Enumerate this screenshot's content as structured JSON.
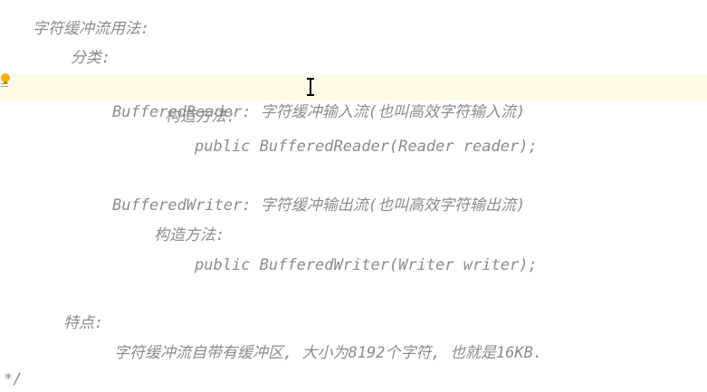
{
  "editor": {
    "top_mark": "'",
    "lines": [
      "字符缓冲流用法:",
      "分类:",
      "BufferedReader: 字符缓冲输入流(也叫高效字符输入流)",
      "构造方法:",
      "public BufferedReader(Reader reader);",
      "BufferedWriter: 字符缓冲输出流(也叫高效字符输出流)",
      "构造方法:",
      "public BufferedWriter(Writer writer);",
      "特点:",
      "字符缓冲流自带有缓冲区, 大小为8192个字符, 也就是16KB.",
      "*/"
    ]
  },
  "colors": {
    "comment_text": "#8c8c8c",
    "current_line_bg": "#fdfbe6",
    "bulb": "#f0b400"
  },
  "icons": {
    "gutter": "lightbulb-icon",
    "fold": "fold-lines-icon",
    "cursor": "text-cursor-icon"
  }
}
